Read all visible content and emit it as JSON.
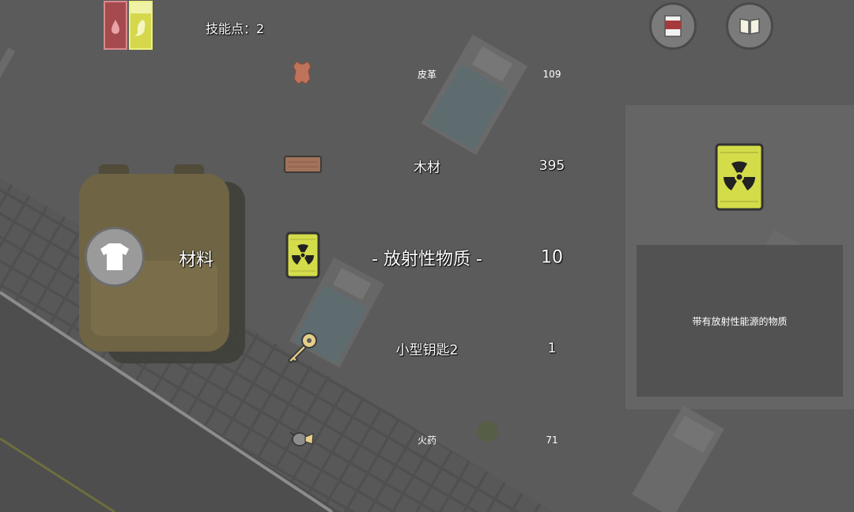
{
  "hud": {
    "skill_points": "技能点：2",
    "status_bars": [
      {
        "name": "blood",
        "color": "#a54a4d",
        "border": "#d57e84"
      },
      {
        "name": "hunger",
        "color": "#d4d84a",
        "border": "#e9ee7a"
      }
    ],
    "buttons": [
      {
        "name": "inventory-can-button",
        "icon": "can-icon"
      },
      {
        "name": "journal-button",
        "icon": "book-icon"
      }
    ]
  },
  "category": {
    "label": "材料",
    "icon": "shirt-icon"
  },
  "items": [
    {
      "name": "皮革",
      "count": "109",
      "icon": "leather-icon",
      "size": "small"
    },
    {
      "name": "木材",
      "count": "395",
      "icon": "wood-plank-icon",
      "size": "medium"
    },
    {
      "name": "- 放射性物质 -",
      "count": "10",
      "icon": "radioactive-barrel-icon",
      "size": "large",
      "selected": true
    },
    {
      "name": "小型钥匙2",
      "count": "1",
      "icon": "key-icon",
      "size": "medium"
    },
    {
      "name": "火药",
      "count": "71",
      "icon": "gunpowder-icon",
      "size": "small"
    }
  ],
  "detail": {
    "icon": "radioactive-barrel-icon",
    "description": "带有放射性能源的物质"
  },
  "colors": {
    "radioactive_yellow": "#d4dc4a",
    "ground": "#5a5a5a",
    "road": "#4f4f4f"
  }
}
